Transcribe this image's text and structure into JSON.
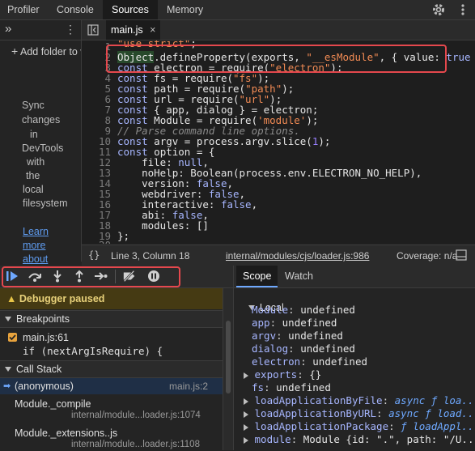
{
  "top_tabs": [
    "Profiler",
    "Console",
    "Sources",
    "Memory"
  ],
  "active_top_tab": "Sources",
  "navigator": {
    "add_folder_label": "Add folder to workspace",
    "sync_text": [
      "Sync",
      "changes",
      "in",
      "DevTools",
      "with",
      "the",
      "local",
      "filesystem"
    ],
    "learn_more": [
      "Learn",
      "more",
      "about"
    ]
  },
  "editor": {
    "file_tab": "main.js",
    "lines": [
      {
        "n": "1",
        "text": "\"use strict\";"
      },
      {
        "n": "2",
        "text": "Object.defineProperty(exports, \"__esModule\", { value: true"
      },
      {
        "n": "3",
        "text": "const electron = require(\"electron\");"
      },
      {
        "n": "4",
        "text": "const fs = require(\"fs\");"
      },
      {
        "n": "5",
        "text": "const path = require(\"path\");"
      },
      {
        "n": "6",
        "text": "const url = require(\"url\");"
      },
      {
        "n": "7",
        "text": "const { app, dialog } = electron;"
      },
      {
        "n": "8",
        "text": "const Module = require('module');"
      },
      {
        "n": "9",
        "text": "// Parse command line options."
      },
      {
        "n": "10",
        "text": "const argv = process.argv.slice(1);"
      },
      {
        "n": "11",
        "text": "const option = {"
      },
      {
        "n": "12",
        "text": "    file: null,"
      },
      {
        "n": "13",
        "text": "    noHelp: Boolean(process.env.ELECTRON_NO_HELP),"
      },
      {
        "n": "14",
        "text": "    version: false,"
      },
      {
        "n": "15",
        "text": "    webdriver: false,"
      },
      {
        "n": "16",
        "text": "    interactive: false,"
      },
      {
        "n": "17",
        "text": "    abi: false,"
      },
      {
        "n": "18",
        "text": "    modules: []"
      },
      {
        "n": "19",
        "text": "};"
      },
      {
        "n": "20",
        "text": ""
      }
    ]
  },
  "status": {
    "braces": "{}",
    "position": "Line 3, Column 18",
    "source": "internal/modules/cjs/loader.js:986",
    "coverage": "Coverage: n/a"
  },
  "debugger": {
    "paused": "Debugger paused",
    "breakpoints_title": "Breakpoints",
    "breakpoint_file": "main.js:61",
    "breakpoint_code": "if (nextArgIsRequire) {",
    "call_stack_title": "Call Stack",
    "frames": [
      {
        "name": "(anonymous)",
        "loc": "main.js:2"
      },
      {
        "name": "Module._compile",
        "loc": "internal/module...loader.js:1074"
      },
      {
        "name": "Module._extensions..js",
        "loc": "internal/module...loader.js:1108"
      }
    ]
  },
  "scope": {
    "tabs": [
      "Scope",
      "Watch"
    ],
    "local_title": "Local",
    "entries": [
      {
        "k": "Module",
        "v": "undefined",
        "expand": false
      },
      {
        "k": "app",
        "v": "undefined",
        "expand": false
      },
      {
        "k": "argv",
        "v": "undefined",
        "expand": false
      },
      {
        "k": "dialog",
        "v": "undefined",
        "expand": false
      },
      {
        "k": "electron",
        "v": "undefined",
        "expand": false
      },
      {
        "k": "exports",
        "v": "{}",
        "expand": true
      },
      {
        "k": "fs",
        "v": "undefined",
        "expand": false
      },
      {
        "k": "loadApplicationByFile",
        "v": "async ƒ loa...",
        "expand": true,
        "fn": true
      },
      {
        "k": "loadApplicationByURL",
        "v": "async ƒ load...",
        "expand": true,
        "fn": true
      },
      {
        "k": "loadApplicationPackage",
        "v": "ƒ loadAppl...",
        "expand": true,
        "fn": true
      },
      {
        "k": "module",
        "v": "Module {id: \".\", path: \"/U...",
        "expand": true
      }
    ]
  },
  "colors": {
    "accent": "#6ea8fe",
    "highlight_box": "#e5484d",
    "paused_bg": "#453a13"
  }
}
